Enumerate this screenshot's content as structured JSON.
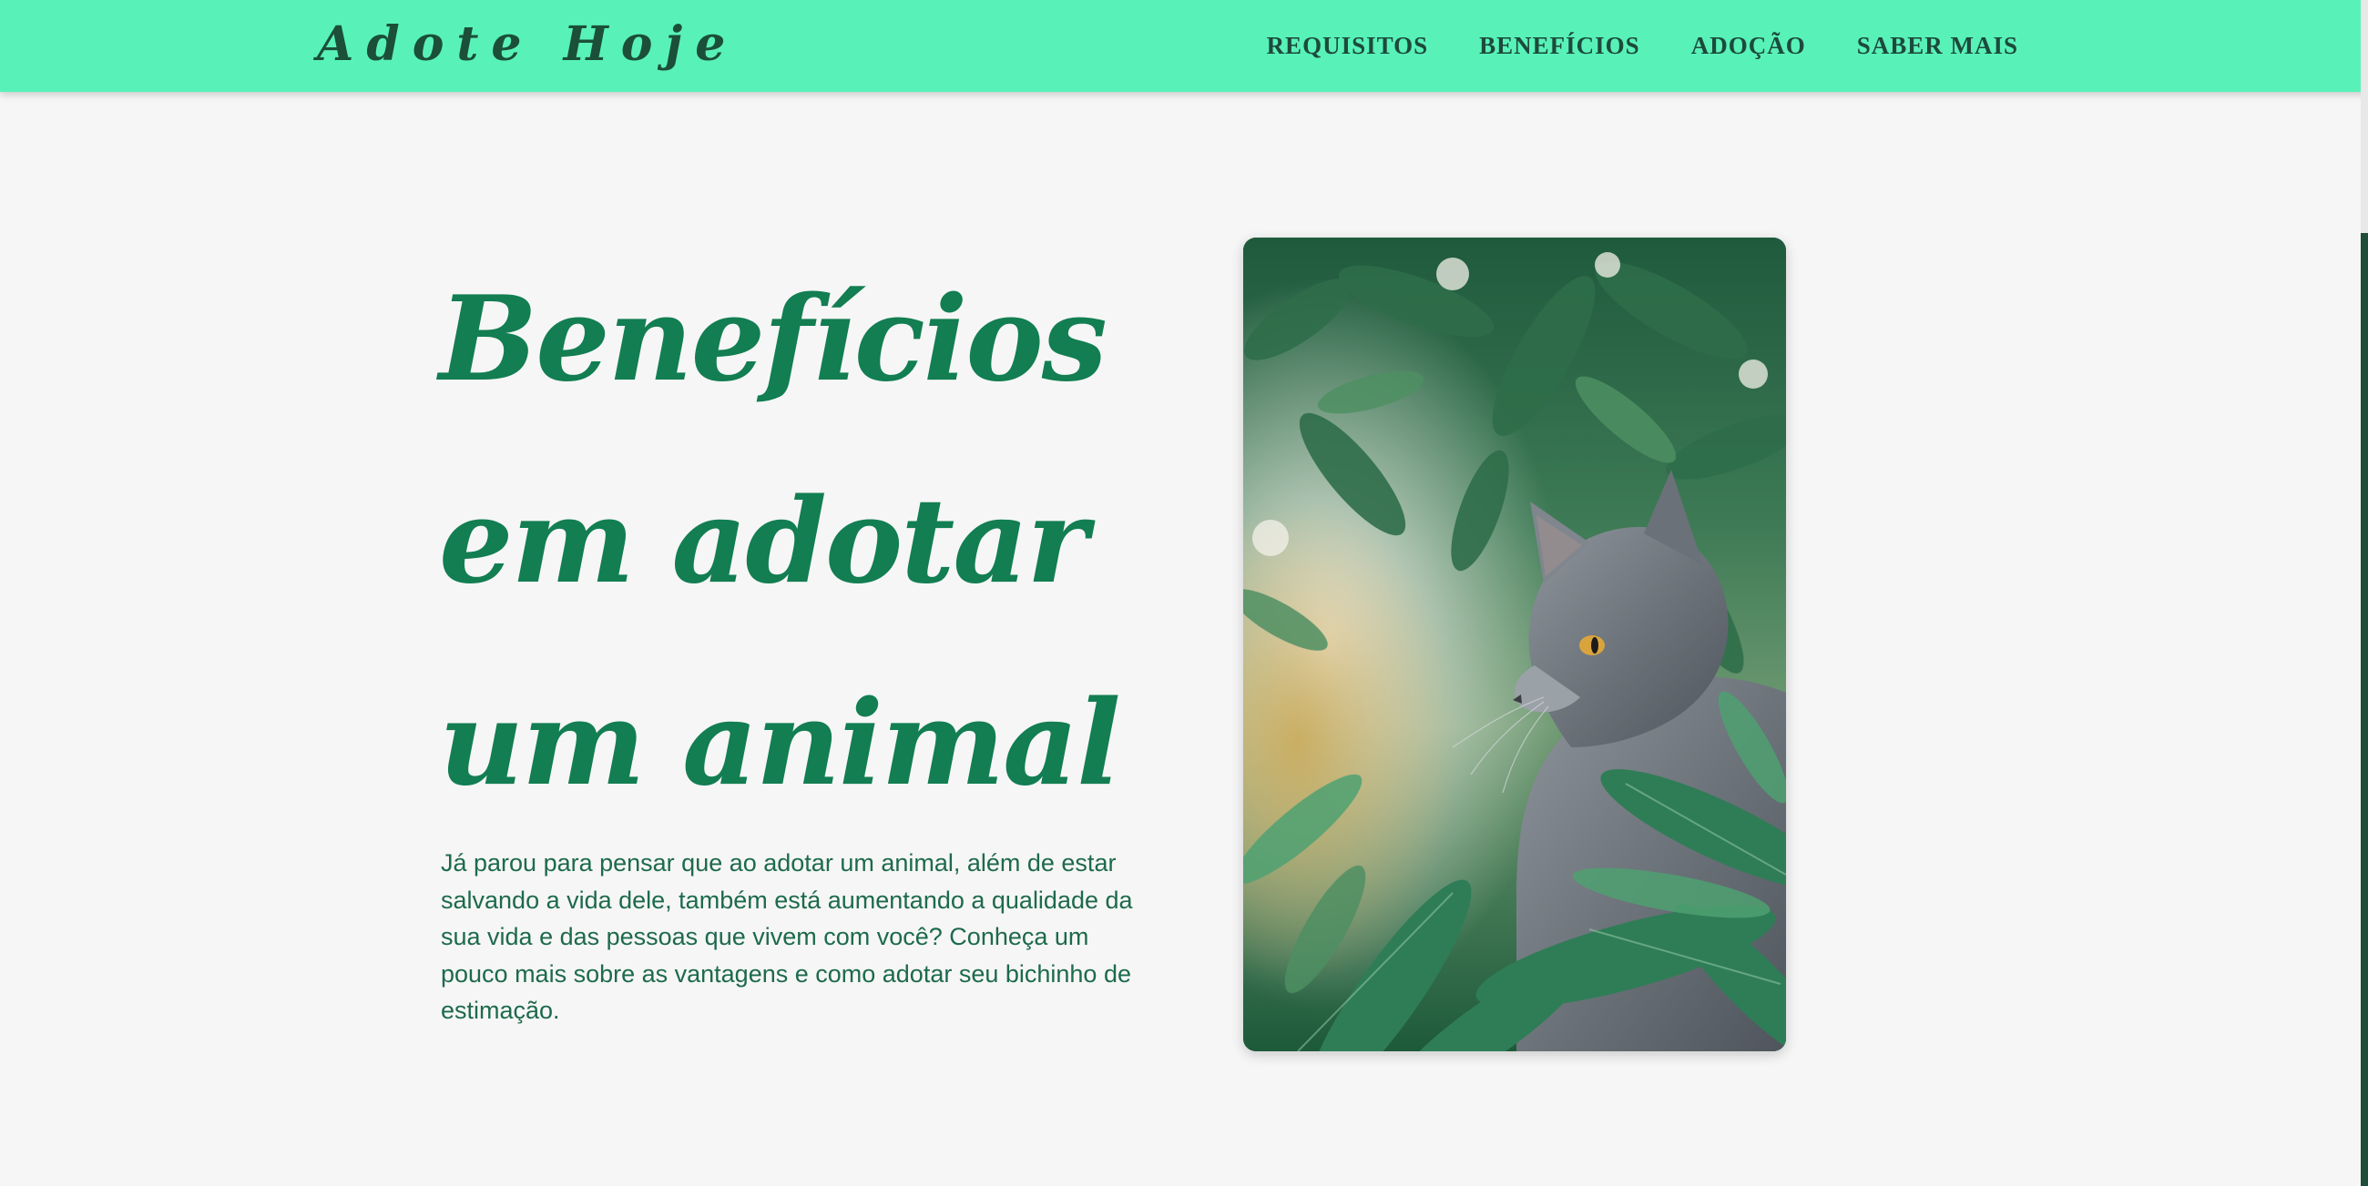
{
  "header": {
    "logo": "Adote Hoje",
    "nav": [
      {
        "label": "REQUISITOS"
      },
      {
        "label": "BENEFÍCIOS"
      },
      {
        "label": "ADOÇÃO"
      },
      {
        "label": "SABER MAIS"
      }
    ]
  },
  "hero": {
    "title": "Benefícios em adotar um animal",
    "paragraph": "Já parou para pensar que ao adotar um animal, além de estar salvando a vida dele, também está aumentando a qualidade da sua vida e das pessoas que vivem com você? Conheça um pouco mais sobre as vantagens e como adotar seu bichinho de estimação."
  },
  "colors": {
    "header_bg": "#58f2b9",
    "heading": "#127e52",
    "body_text": "#1d6a4c",
    "page_bg": "#f6f6f6",
    "nav_text": "#1d4a3c"
  },
  "icons": {
    "photo": "cat-in-leaves-photo"
  }
}
